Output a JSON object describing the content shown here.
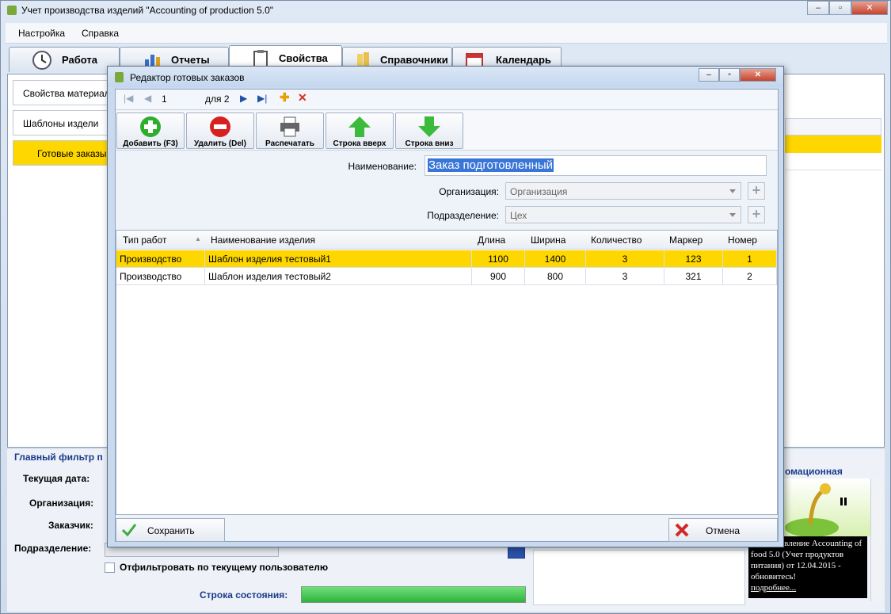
{
  "window": {
    "title": "Учет производства изделий \"Accounting of production 5.0\""
  },
  "menu": {
    "items": [
      "Настройка",
      "Справка"
    ]
  },
  "tabs": [
    {
      "label": "Работа",
      "icon": "clock-icon"
    },
    {
      "label": "Отчеты",
      "icon": "chart-icon"
    },
    {
      "label": "Свойства",
      "icon": "clipboard-icon"
    },
    {
      "label": "Справочники",
      "icon": "books-icon"
    },
    {
      "label": "Календарь",
      "icon": "calendar-icon"
    }
  ],
  "left_panel": {
    "items": [
      "Свойства материал",
      "Шаблоны издели",
      "Готовые заказы"
    ]
  },
  "bottom_panel": {
    "filter_title": "Главный фильтр п",
    "current_date_label": "Текущая дата:",
    "org_label": "Организация:",
    "customer_label": "Заказчик:",
    "division_label": "Подразделение:",
    "filter_user_label": "Отфильтровать по текущему пользователю",
    "status_label": "Строка состояния:",
    "info_title": "омационная",
    "news_text": "ие! Обновление Accounting of food 5.0 (Учет продуктов питания) от 12.04.2015 - обновитесь!",
    "news_link": "подробнее..."
  },
  "dialog": {
    "title": "Редактор готовых заказов",
    "nav": {
      "current": "1",
      "of_label": "для 2"
    },
    "toolbar": {
      "add": "Добавить (F3)",
      "delete": "Удалить (Del)",
      "print": "Распечатать",
      "row_up": "Строка вверх",
      "row_down": "Строка вниз"
    },
    "form": {
      "name_label": "Наименование:",
      "name_value": "Заказ подготовленный",
      "org_label": "Организация:",
      "org_placeholder": "Организация",
      "div_label": "Подразделение:",
      "div_value": "Цех"
    },
    "grid": {
      "columns": [
        "Тип работ",
        "Наименование изделия",
        "Длина",
        "Ширина",
        "Количество",
        "Маркер",
        "Номер"
      ],
      "rows": [
        [
          "Производство",
          "Шаблон изделия тестовый1",
          "1100",
          "1400",
          "3",
          "123",
          "1"
        ],
        [
          "Производство",
          "Шаблон изделия тестовый2",
          "900",
          "800",
          "3",
          "321",
          "2"
        ]
      ]
    },
    "save": "Сохранить",
    "cancel": "Отмена"
  },
  "colors": {
    "selected_row": "#ffd700",
    "status_bar": "#3cc24a"
  }
}
